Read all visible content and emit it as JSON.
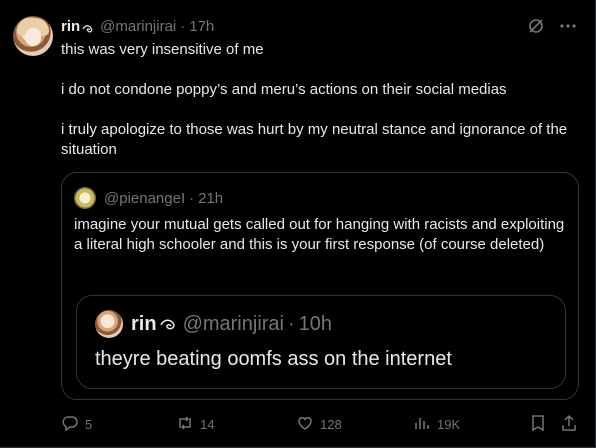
{
  "post": {
    "author_name": "rin",
    "handle": "@marinjirai",
    "time": "17h",
    "dot": "·",
    "body": [
      "this was very insensitive of me",
      "i do not condone poppy’s and meru’s actions on their social medias",
      "i truly apologize to those was hurt by my neutral stance and ignorance of the situation"
    ]
  },
  "quote": {
    "handle": "@pienangeI",
    "time": "21h",
    "dot": "·",
    "text": "imagine your mutual gets called out for hanging with racists and exploiting a literal high schooler and this is your first response (of course deleted)",
    "inner": {
      "author_name": "rin",
      "handle": "@marinjirai",
      "time": "10h",
      "dot": "·",
      "text": "theyre beating oomfs ass on the internet"
    }
  },
  "actions": {
    "replies": "5",
    "retweets": "14",
    "likes": "128",
    "views": "19K"
  },
  "icons": {
    "top": [
      "grok-icon",
      "more-icon"
    ],
    "actions": [
      "reply-icon",
      "retweet-icon",
      "like-icon",
      "views-icon",
      "bookmark-icon",
      "share-icon"
    ]
  },
  "colors": {
    "background": "#000000",
    "text": "#e7e9ea",
    "muted": "#71767b",
    "border": "#2f3336"
  }
}
